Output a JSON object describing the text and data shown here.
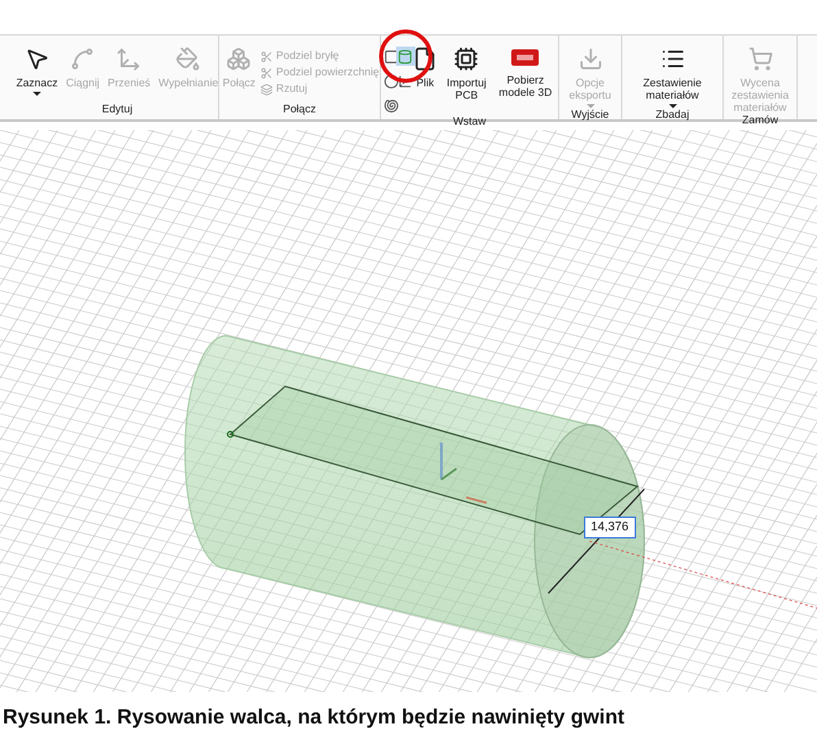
{
  "ribbon": {
    "groups": [
      {
        "title": "Edytuj",
        "items": [
          {
            "kind": "large",
            "label": "Zaznacz",
            "disabled": false,
            "dropdown": true
          },
          {
            "kind": "large",
            "label": "Ciągnij",
            "disabled": true
          },
          {
            "kind": "large",
            "label": "Przenieś",
            "disabled": true
          },
          {
            "kind": "large",
            "label": "Wypełnianie",
            "disabled": true
          }
        ]
      },
      {
        "title": "Połącz",
        "items": [
          {
            "kind": "large",
            "label": "Połącz",
            "disabled": true
          },
          {
            "kind": "small",
            "label": "Podziel bryłę",
            "disabled": true
          },
          {
            "kind": "small",
            "label": "Podziel powierzchnię",
            "disabled": true
          },
          {
            "kind": "small",
            "label": "Rzutuj",
            "disabled": true
          }
        ]
      },
      {
        "title": "Wstaw",
        "items": [
          {
            "kind": "tool",
            "selected": false
          },
          {
            "kind": "tool",
            "selected": true
          },
          {
            "kind": "tool",
            "selected": false
          },
          {
            "kind": "tool",
            "selected": false
          },
          {
            "kind": "tool",
            "selected": false
          },
          {
            "kind": "large",
            "label": "Plik",
            "disabled": false
          },
          {
            "kind": "large",
            "label": "Importuj PCB",
            "disabled": false
          },
          {
            "kind": "large",
            "label": "Pobierz modele 3D",
            "disabled": false
          }
        ]
      },
      {
        "title": "Wyjście",
        "items": [
          {
            "kind": "large",
            "label": "Opcje eksportu",
            "disabled": true,
            "dropdown": true
          }
        ]
      },
      {
        "title": "Zbadaj",
        "items": [
          {
            "kind": "large",
            "label": "Zestawienie materiałów",
            "disabled": false,
            "dropdown": true
          }
        ]
      },
      {
        "title": "Zamów",
        "items": [
          {
            "kind": "large",
            "label": "Wycena zestawienia materiałów",
            "disabled": true
          }
        ]
      }
    ]
  },
  "viewport": {
    "dimension": "14,376"
  },
  "caption": "Rysunek 1. Rysowanie walca, na którym będzie nawinięty gwint"
}
